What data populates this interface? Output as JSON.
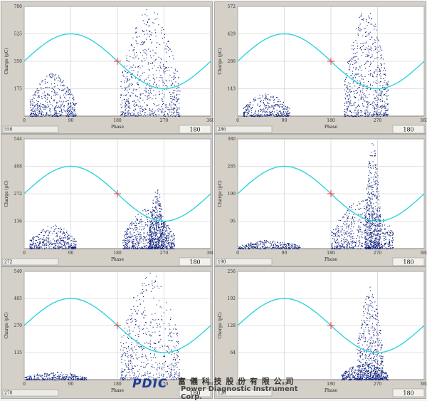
{
  "chart_data": [
    {
      "type": "scatter",
      "xlabel": "Phase",
      "ylabel": "Charge (pC)",
      "x_ticks": [
        "0",
        "90",
        "180",
        "270",
        "360"
      ],
      "y_ticks": [
        "175",
        "350",
        "525",
        "700"
      ],
      "xlim": [
        0,
        360
      ],
      "ylim": [
        0,
        700
      ],
      "max_label": "550",
      "phase_label": "180",
      "grid": true,
      "colors": {
        "points": "#0d1f7c",
        "sine": "#2fd3dd",
        "marker": "#ff2a2a"
      },
      "sine": {
        "center": 350,
        "amplitude": 175
      },
      "clusters": [
        {
          "x_range": [
            10,
            100
          ],
          "y_peak": 280,
          "density": 0.55
        },
        {
          "x_range": [
            185,
            300
          ],
          "y_peak": 690,
          "density": 0.75
        }
      ]
    },
    {
      "type": "scatter",
      "xlabel": "Phase",
      "ylabel": "Charge (pC)",
      "x_ticks": [
        "0",
        "90",
        "180",
        "270",
        "360"
      ],
      "y_ticks": [
        "143",
        "286",
        "429",
        "572"
      ],
      "xlim": [
        0,
        360
      ],
      "ylim": [
        0,
        572
      ],
      "max_label": "286",
      "phase_label": "180",
      "grid": true,
      "colors": {
        "points": "#0d1f7c",
        "sine": "#2fd3dd",
        "marker": "#ff2a2a"
      },
      "sine": {
        "center": 286,
        "amplitude": 143
      },
      "clusters": [
        {
          "x_range": [
            10,
            100
          ],
          "y_peak": 120,
          "density": 0.4
        },
        {
          "x_range": [
            205,
            290
          ],
          "y_peak": 560,
          "density": 0.75
        }
      ]
    },
    {
      "type": "scatter",
      "xlabel": "Phase",
      "ylabel": "Charge (pC)",
      "x_ticks": [
        "0",
        "90",
        "180",
        "270",
        "360"
      ],
      "y_ticks": [
        "136",
        "272",
        "408",
        "544"
      ],
      "xlim": [
        0,
        360
      ],
      "ylim": [
        0,
        544
      ],
      "max_label": "272",
      "phase_label": "180",
      "grid": true,
      "colors": {
        "points": "#0d1f7c",
        "sine": "#2fd3dd",
        "marker": "#ff2a2a"
      },
      "sine": {
        "center": 272,
        "amplitude": 136
      },
      "clusters": [
        {
          "x_range": [
            10,
            100
          ],
          "y_peak": 120,
          "density": 0.45
        },
        {
          "x_range": [
            190,
            290
          ],
          "y_peak": 200,
          "density": 0.7
        },
        {
          "x_range": [
            240,
            270
          ],
          "y_peak": 300,
          "density": 0.5
        }
      ]
    },
    {
      "type": "scatter",
      "xlabel": "Phase",
      "ylabel": "Charge (pC)",
      "x_ticks": [
        "0",
        "90",
        "180",
        "270",
        "360"
      ],
      "y_ticks": [
        "95",
        "190",
        "285",
        "380"
      ],
      "xlim": [
        0,
        360
      ],
      "ylim": [
        0,
        380
      ],
      "max_label": "190",
      "phase_label": "180",
      "grid": true,
      "colors": {
        "points": "#0d1f7c",
        "sine": "#2fd3dd",
        "marker": "#ff2a2a"
      },
      "sine": {
        "center": 190,
        "amplitude": 95
      },
      "clusters": [
        {
          "x_range": [
            0,
            120
          ],
          "y_peak": 30,
          "density": 0.35
        },
        {
          "x_range": [
            180,
            300
          ],
          "y_peak": 170,
          "density": 0.7
        },
        {
          "x_range": [
            245,
            275
          ],
          "y_peak": 370,
          "density": 0.55
        }
      ]
    },
    {
      "type": "scatter",
      "xlabel": "Phase",
      "ylabel": "Charge (pC)",
      "x_ticks": [
        "0",
        "90",
        "180",
        "270",
        "360"
      ],
      "y_ticks": [
        "135",
        "270",
        "405",
        "540"
      ],
      "xlim": [
        0,
        360
      ],
      "ylim": [
        0,
        540
      ],
      "max_label": "270",
      "phase_label": "180",
      "grid": true,
      "colors": {
        "points": "#0d1f7c",
        "sine": "#2fd3dd",
        "marker": "#ff2a2a"
      },
      "sine": {
        "center": 270,
        "amplitude": 135
      },
      "clusters": [
        {
          "x_range": [
            0,
            120
          ],
          "y_peak": 40,
          "density": 0.35
        },
        {
          "x_range": [
            185,
            300
          ],
          "y_peak": 540,
          "density": 0.6
        }
      ]
    },
    {
      "type": "scatter",
      "xlabel": "Phase",
      "ylabel": "Charge (pC)",
      "x_ticks": [
        "0",
        "90",
        "180",
        "270",
        "360"
      ],
      "y_ticks": [
        "64",
        "128",
        "192",
        "256"
      ],
      "xlim": [
        0,
        360
      ],
      "ylim": [
        0,
        256
      ],
      "max_label": "128",
      "phase_label": "180",
      "grid": true,
      "colors": {
        "points": "#0d1f7c",
        "sine": "#2fd3dd",
        "marker": "#ff2a2a"
      },
      "sine": {
        "center": 128,
        "amplitude": 64
      },
      "clusters": [
        {
          "x_range": [
            200,
            290
          ],
          "y_peak": 40,
          "density": 0.5
        },
        {
          "x_range": [
            230,
            280
          ],
          "y_peak": 220,
          "density": 0.55
        }
      ]
    }
  ],
  "watermark": {
    "logo": "PDIC",
    "company_cn": "富 儀 科 技 股 份 有 限 公 司",
    "company_en": "Power Diagnostic Instrument Corp."
  }
}
